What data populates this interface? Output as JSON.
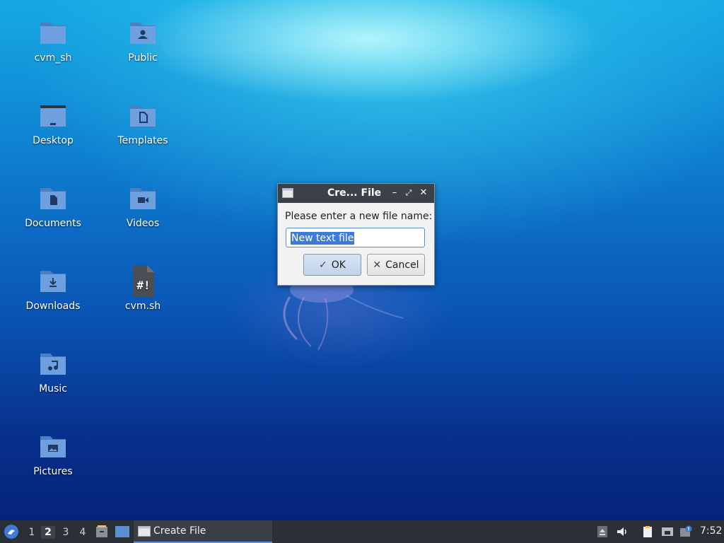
{
  "desktop": {
    "icons": [
      {
        "label": "cvm_sh",
        "icon": "folder-icon"
      },
      {
        "label": "Public",
        "icon": "folder-public-icon"
      },
      {
        "label": "Desktop",
        "icon": "folder-desktop-icon"
      },
      {
        "label": "Templates",
        "icon": "folder-templates-icon"
      },
      {
        "label": "Documents",
        "icon": "folder-documents-icon"
      },
      {
        "label": "Videos",
        "icon": "folder-videos-icon"
      },
      {
        "label": "Downloads",
        "icon": "folder-downloads-icon"
      },
      {
        "label": "cvm.sh",
        "icon": "script-file-icon"
      },
      {
        "label": "Music",
        "icon": "folder-music-icon"
      },
      {
        "label": "Pictures",
        "icon": "folder-pictures-icon"
      }
    ]
  },
  "dialog": {
    "title": "Cre... File",
    "prompt": "Please enter a new file name:",
    "filename_value": "New text file",
    "ok_label": "OK",
    "cancel_label": "Cancel"
  },
  "taskbar": {
    "workspaces": [
      "1",
      "2",
      "3",
      "4"
    ],
    "active_workspace": "2",
    "task_label": "Create File",
    "clock": "7:52"
  },
  "colors": {
    "accent": "#3d7bd5",
    "folder": "#5b8fd1",
    "taskbar_bg": "#2b2f36",
    "titlebar_bg": "#3c4048"
  }
}
